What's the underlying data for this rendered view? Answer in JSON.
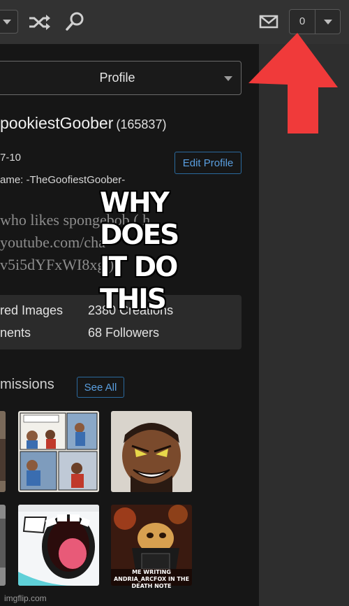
{
  "topbar": {
    "icons": {
      "shuffle": "shuffle-icon",
      "search": "search-icon",
      "mail": "mail-icon"
    },
    "notification_count": "0"
  },
  "profile_select": {
    "label": "Profile"
  },
  "profile": {
    "username": "pookiestGoober",
    "points": "(165837)",
    "joined": "7-10",
    "alt_name": "ame: -TheGoofiestGoober-",
    "edit_label": "Edit Profile",
    "bio_lines": [
      "who likes spongebob ( h",
      "youtube.com/cha",
      "v5i5dYFxWI8xg )"
    ]
  },
  "stats": {
    "featured_images": "red Images",
    "creations": "2380 Creations",
    "comments": "nents",
    "followers": "68 Followers"
  },
  "submissions": {
    "heading": "missions",
    "see_all": "See All",
    "thumb_captions": [
      "ME WRITING ANDRIA_ARCFOX IN THE DEATH NOTE"
    ]
  },
  "footer": {
    "watermark": "imgflip.com"
  },
  "meme": {
    "caption_lines": [
      "WHY DOES",
      "IT DO THIS"
    ],
    "arrow_color": "#f03a3a"
  },
  "colors": {
    "accent": "#5a9fe0",
    "topbar": "#323232",
    "panel": "#2b2b2b"
  }
}
